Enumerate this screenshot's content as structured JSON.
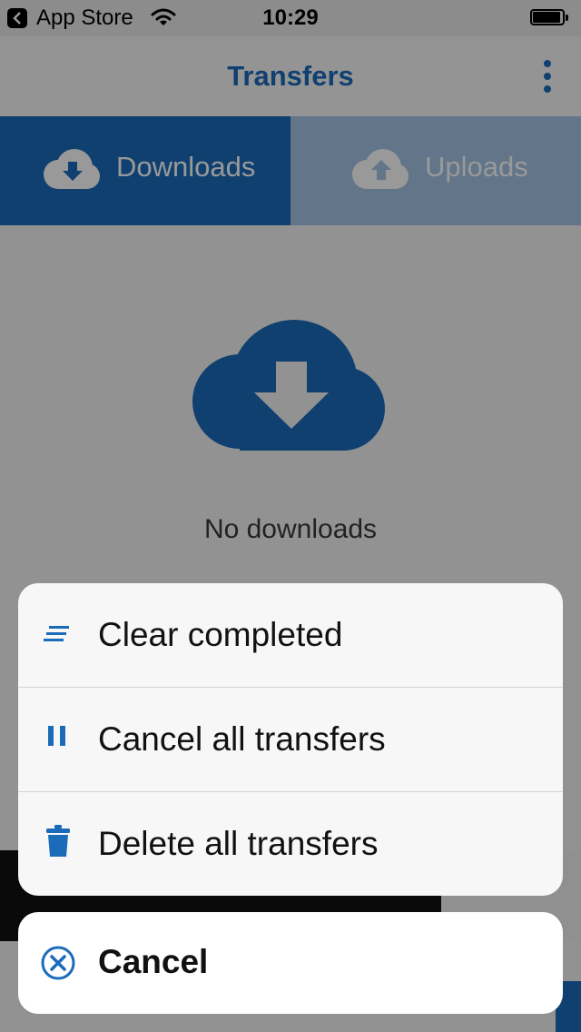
{
  "status_bar": {
    "back_app": "App Store",
    "time": "10:29"
  },
  "nav": {
    "title": "Transfers"
  },
  "tabs": [
    {
      "label": "Downloads",
      "icon": "cloud-download-icon",
      "selected": true
    },
    {
      "label": "Uploads",
      "icon": "cloud-upload-icon",
      "selected": false
    }
  ],
  "main": {
    "empty_message": "No downloads"
  },
  "action_sheet": {
    "items": [
      {
        "label": "Clear completed",
        "icon": "clear-list-icon"
      },
      {
        "label": "Cancel all transfers",
        "icon": "pause-icon"
      },
      {
        "label": "Delete all transfers",
        "icon": "trash-icon"
      }
    ],
    "cancel_label": "Cancel"
  },
  "colors": {
    "accent": "#1b6bbb",
    "tab_inactive": "#a3c3e4"
  }
}
